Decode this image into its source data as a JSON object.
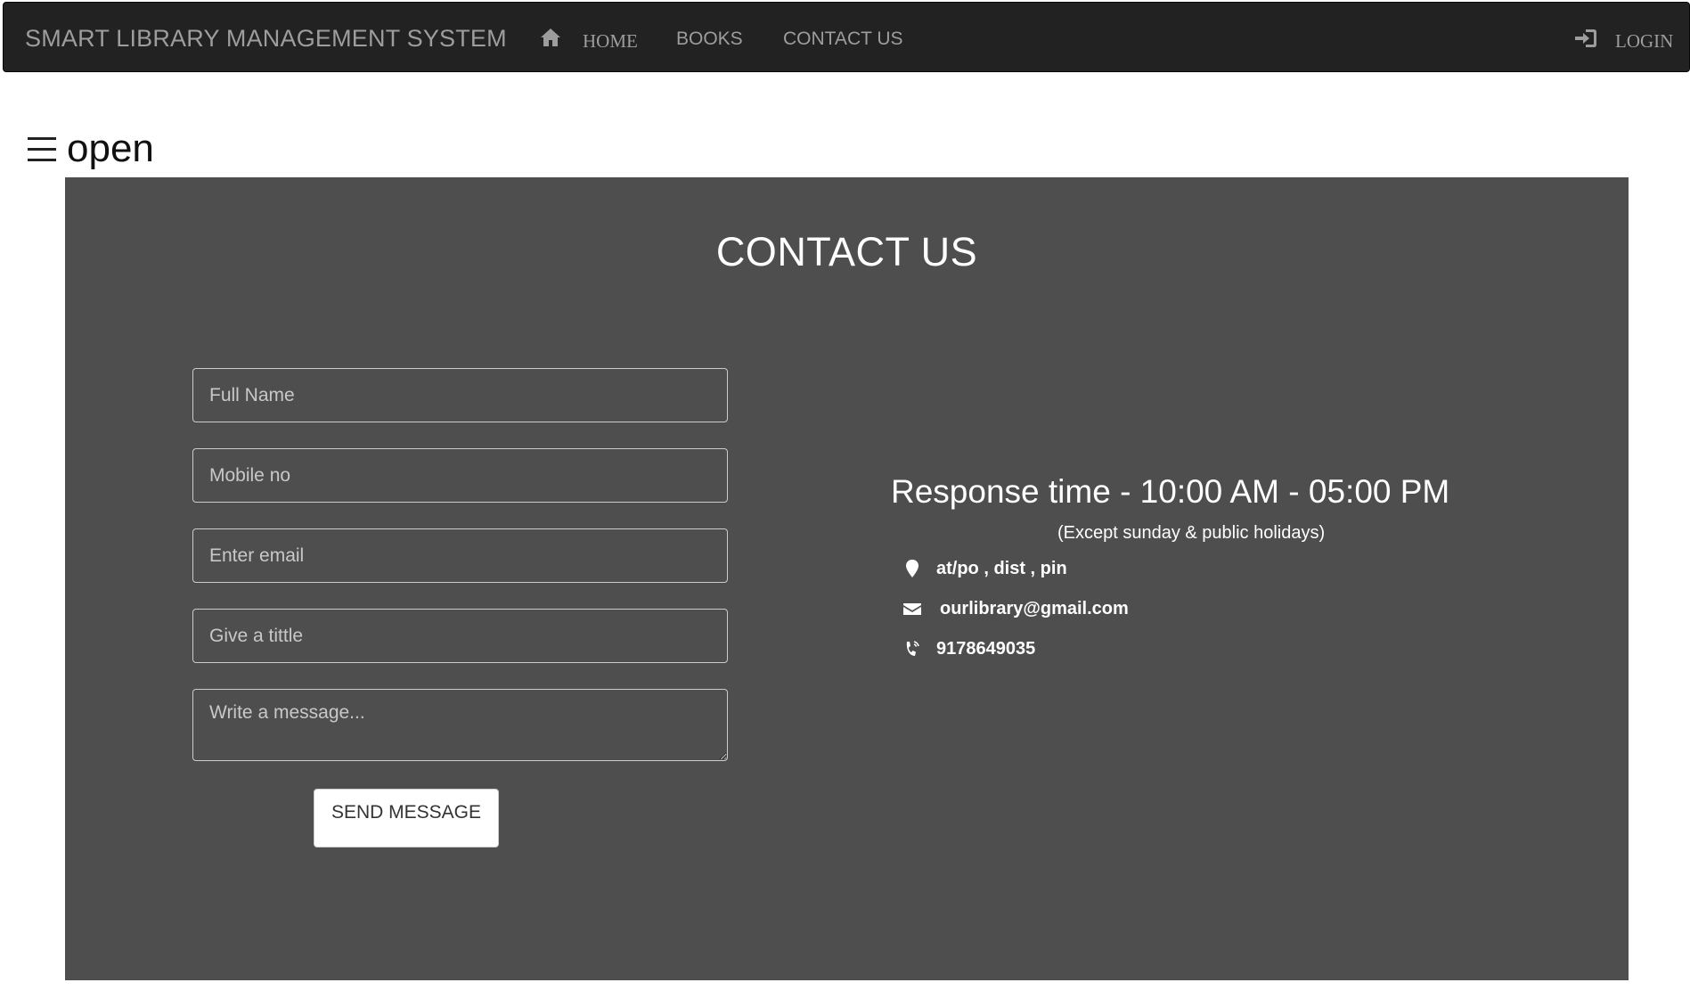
{
  "navbar": {
    "brand": "SMART LIBRARY MANAGEMENT SYSTEM",
    "links": [
      {
        "label": "HOME",
        "icon": "home-icon"
      },
      {
        "label": "BOOKS"
      },
      {
        "label": "CONTACT US"
      }
    ],
    "login": {
      "label": "LOGIN",
      "icon": "login-icon"
    }
  },
  "sidebar_toggle": {
    "icon": "hamburger-icon",
    "label": "open"
  },
  "contact": {
    "title": "CONTACT US",
    "form": {
      "full_name_placeholder": "Full Name",
      "mobile_placeholder": "Mobile no",
      "email_placeholder": "Enter email",
      "title_placeholder": "Give a tittle",
      "message_placeholder": "Write a message...",
      "send_label": "SEND MESSAGE"
    },
    "info": {
      "heading": "Response time - 10:00 AM - 05:00 PM",
      "subheading": "(Except sunday & public holidays)",
      "address": "at/po , dist , pin",
      "email": "ourlibrary@gmail.com",
      "phone": "9178649035"
    }
  },
  "colors": {
    "navbar_bg": "#222222",
    "navbar_text": "#9d9d9d",
    "panel_bg": "#4e4e4e",
    "panel_text": "#ffffff"
  }
}
